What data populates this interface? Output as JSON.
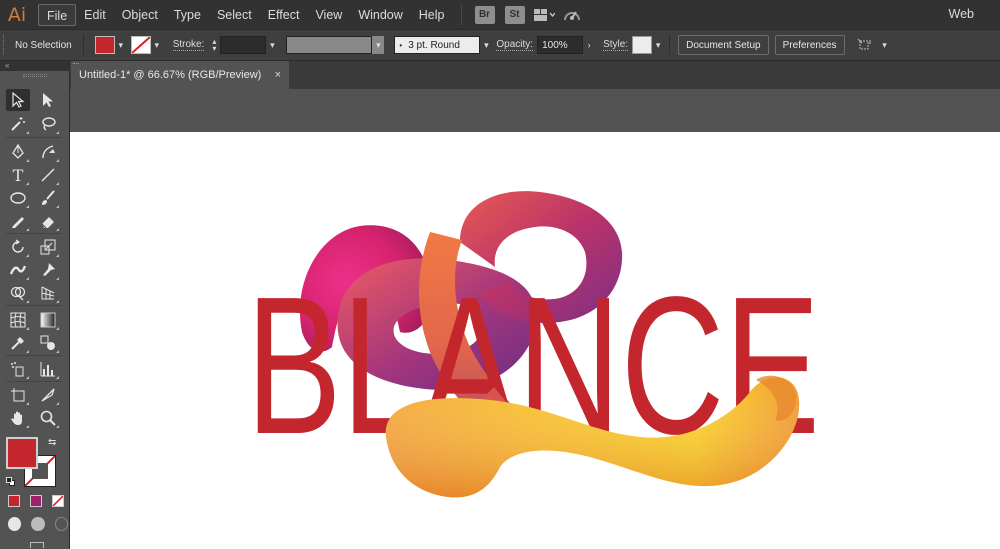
{
  "app": {
    "logo": "Ai",
    "workspace": "Web"
  },
  "menu": [
    "File",
    "Edit",
    "Object",
    "Type",
    "Select",
    "Effect",
    "View",
    "Window",
    "Help"
  ],
  "menubar_icons": {
    "bridge": "Br",
    "stock": "St"
  },
  "control_bar": {
    "selection_status": "No Selection",
    "stroke_label": "Stroke:",
    "brush_value": "3 pt. Round",
    "opacity_label": "Opacity:",
    "opacity_value": "100%",
    "style_label": "Style:",
    "document_setup": "Document Setup",
    "preferences": "Preferences"
  },
  "document_tab": {
    "title": "Untitled-1* @ 66.67% (RGB/Preview)",
    "close": "×"
  },
  "artwork": {
    "text": "BLANCE",
    "text_color": "#c4262e"
  },
  "colors": {
    "fill": "#c4262e",
    "swatch_magenta": "#a0206e",
    "ui_dark": "#323232",
    "ui_mid": "#535353"
  }
}
